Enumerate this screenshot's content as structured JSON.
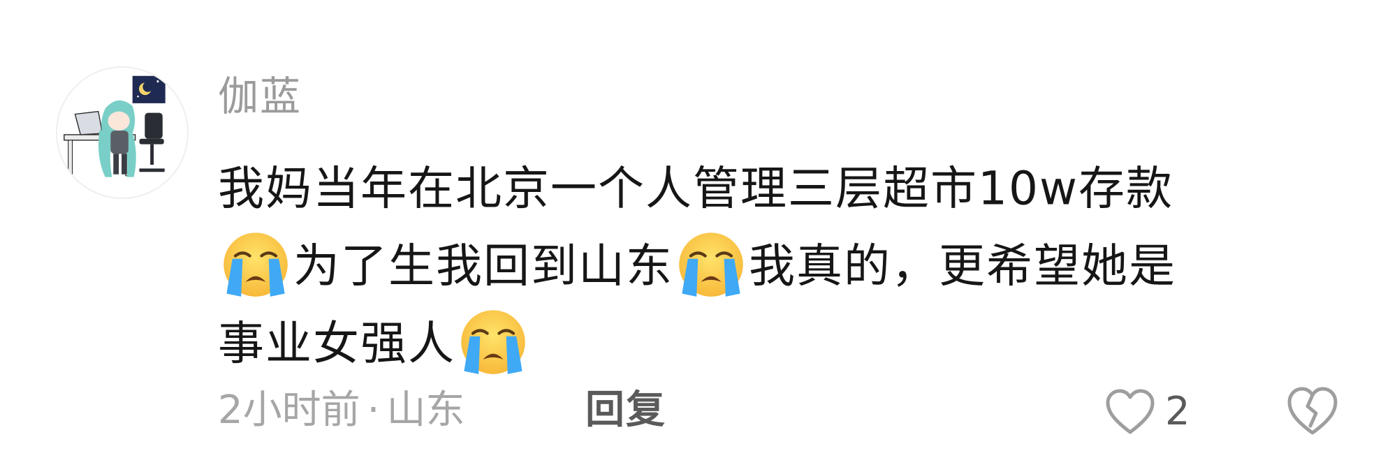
{
  "comment": {
    "username": "伽蓝",
    "content_lines": [
      {
        "parts": [
          {
            "type": "text",
            "value": "我妈当年在北京一个人管理三层超市10w存款"
          }
        ]
      },
      {
        "parts": [
          {
            "type": "emoji",
            "icon": "loudly-crying-face-emoji"
          },
          {
            "type": "text",
            "value": "为了生我回到山东"
          },
          {
            "type": "emoji",
            "icon": "loudly-crying-face-emoji"
          },
          {
            "type": "text",
            "value": "我真的，更希望她是"
          }
        ]
      },
      {
        "parts": [
          {
            "type": "text",
            "value": "事业女强人"
          },
          {
            "type": "emoji",
            "icon": "loudly-crying-face-emoji"
          }
        ]
      }
    ],
    "line1": "我妈当年在北京一个人管理三层超市10w存款",
    "line2_a": "为了生我回到山东",
    "line2_b": "我真的，更希望她是",
    "line3_a": "事业女强人",
    "time": "2小时前",
    "separator": "·",
    "location": "山东",
    "reply_label": "回复",
    "like_count": "2",
    "icons": {
      "avatar": "anime-avatar-at-desk",
      "emoji": "loudly-crying-face-emoji",
      "like": "heart-outline-icon",
      "dislike": "broken-heart-icon"
    },
    "colors": {
      "username": "#9b9b9b",
      "text": "#161616",
      "meta": "#a6a6a6",
      "action": "#5a5a5a"
    }
  }
}
